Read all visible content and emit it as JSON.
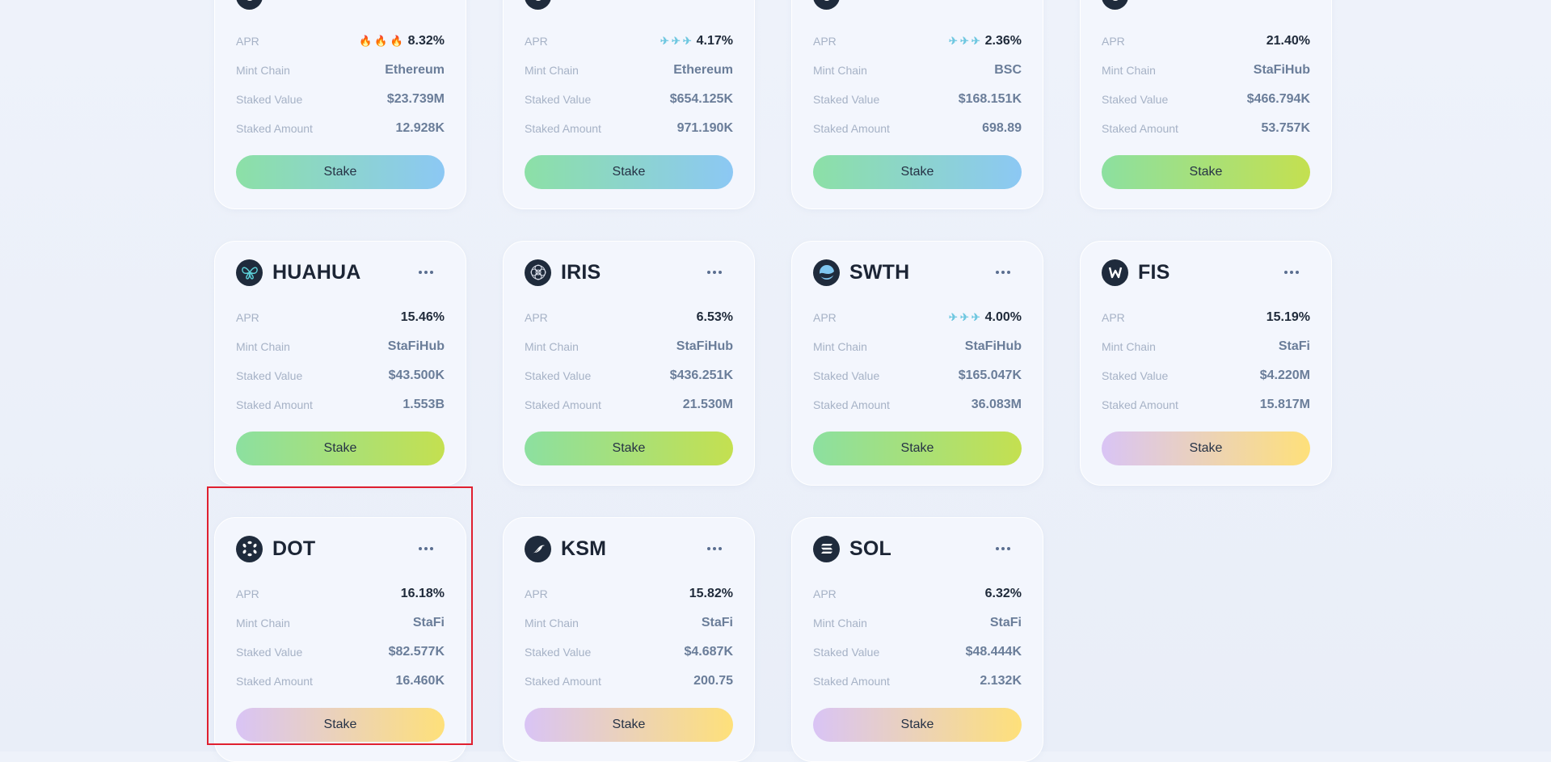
{
  "cards": [
    {
      "name": "",
      "apr": "8.32%",
      "apr_icon": "flame",
      "chain": "Ethereum",
      "value": "$23.739M",
      "amount": "12.928K",
      "btn": "g-blue",
      "logo": "circle-logo"
    },
    {
      "name": "",
      "apr": "4.17%",
      "apr_icon": "rocket",
      "chain": "Ethereum",
      "value": "$654.125K",
      "amount": "971.190K",
      "btn": "g-blue",
      "logo": "circle-logo"
    },
    {
      "name": "",
      "apr": "2.36%",
      "apr_icon": "rocket",
      "chain": "BSC",
      "value": "$168.151K",
      "amount": "698.89",
      "btn": "g-blue",
      "logo": "circle-logo"
    },
    {
      "name": "",
      "apr": "21.40%",
      "apr_icon": "",
      "chain": "StaFiHub",
      "value": "$466.794K",
      "amount": "53.757K",
      "btn": "g-green",
      "logo": "circle-logo"
    },
    {
      "name": "HUAHUA",
      "apr": "15.46%",
      "apr_icon": "",
      "chain": "StaFiHub",
      "value": "$43.500K",
      "amount": "1.553B",
      "btn": "g-green",
      "logo": "butterfly-logo"
    },
    {
      "name": "IRIS",
      "apr": "6.53%",
      "apr_icon": "",
      "chain": "StaFiHub",
      "value": "$436.251K",
      "amount": "21.530M",
      "btn": "g-green",
      "logo": "flower-logo"
    },
    {
      "name": "SWTH",
      "apr": "4.00%",
      "apr_icon": "rocket",
      "chain": "StaFiHub",
      "value": "$165.047K",
      "amount": "36.083M",
      "btn": "g-green",
      "logo": "wave-logo"
    },
    {
      "name": "FIS",
      "apr": "15.19%",
      "apr_icon": "",
      "chain": "StaFi",
      "value": "$4.220M",
      "amount": "15.817M",
      "btn": "g-orange",
      "logo": "w-logo"
    },
    {
      "name": "DOT",
      "apr": "16.18%",
      "apr_icon": "",
      "chain": "StaFi",
      "value": "$82.577K",
      "amount": "16.460K",
      "btn": "g-orange",
      "logo": "dot-logo"
    },
    {
      "name": "KSM",
      "apr": "15.82%",
      "apr_icon": "",
      "chain": "StaFi",
      "value": "$4.687K",
      "amount": "200.75",
      "btn": "g-orange",
      "logo": "bird-logo"
    },
    {
      "name": "SOL",
      "apr": "6.32%",
      "apr_icon": "",
      "chain": "StaFi",
      "value": "$48.444K",
      "amount": "2.132K",
      "btn": "g-orange",
      "logo": "sol-logo"
    }
  ],
  "labels": {
    "apr": "APR",
    "mint_chain": "Mint Chain",
    "staked_value": "Staked Value",
    "staked_amount": "Staked Amount",
    "stake_button": "Stake"
  },
  "highlighted_card": "DOT",
  "colors": {
    "highlight_border": "#e02030",
    "card_bg": "#f3f6fd",
    "page_bg": "#eef2fa"
  }
}
